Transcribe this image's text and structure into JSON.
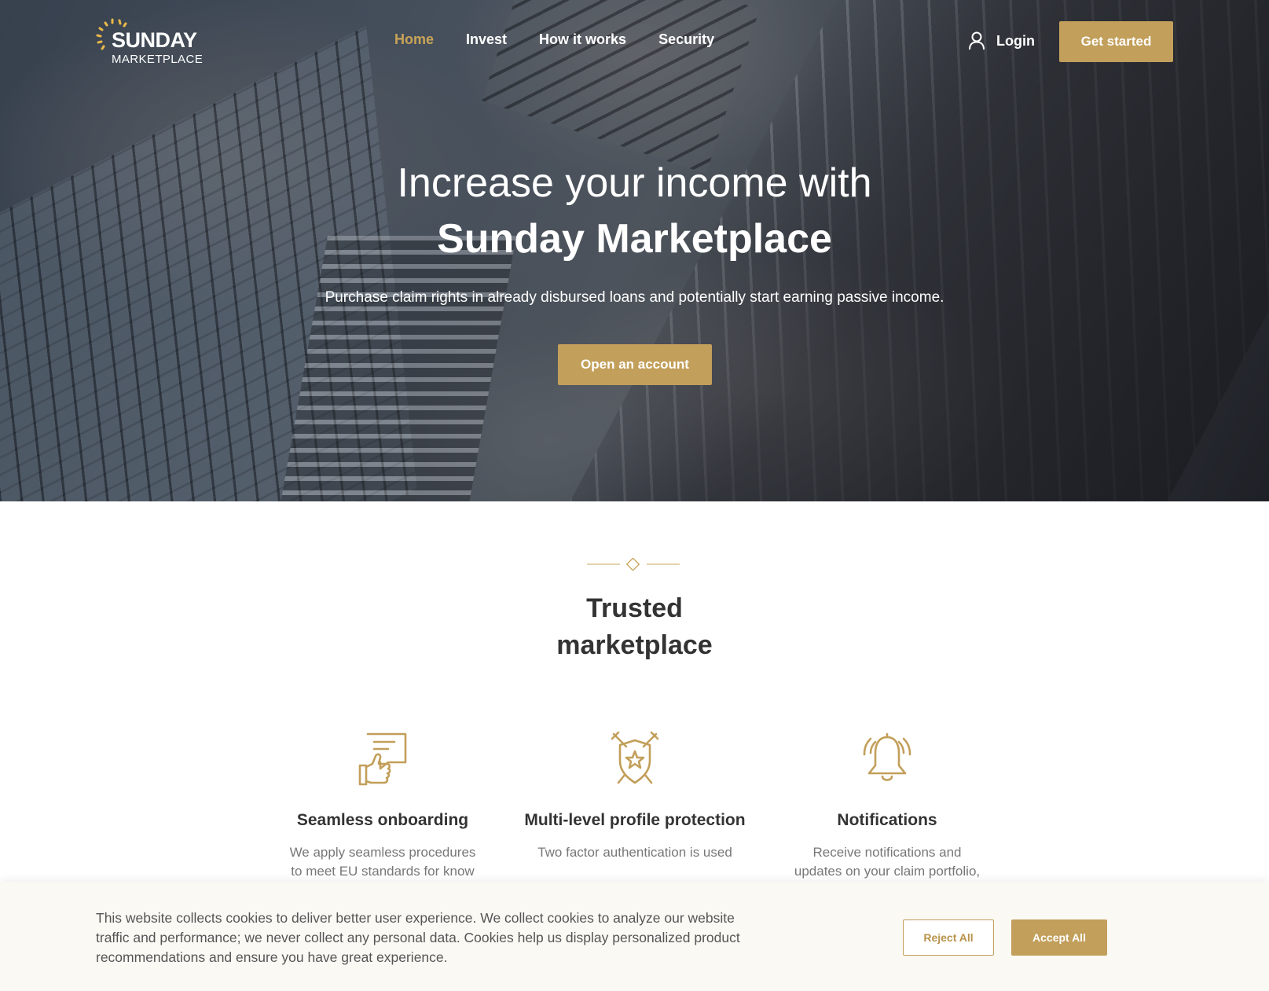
{
  "brand": {
    "name": "SUNDAY",
    "tagline": "MARKETPLACE",
    "accent": "#c29f5a"
  },
  "nav": {
    "links": [
      {
        "label": "Home",
        "active": true
      },
      {
        "label": "Invest",
        "active": false
      },
      {
        "label": "How it works",
        "active": false
      },
      {
        "label": "Security",
        "active": false
      }
    ],
    "login_label": "Login",
    "login_icon": "user-icon",
    "cta_label": "Get started"
  },
  "hero": {
    "title_line1": "Increase your income with",
    "title_line2": "Sunday Marketplace",
    "subtitle": "Purchase claim rights in already disbursed loans and potentially start earning passive income.",
    "cta_label": "Open an account"
  },
  "trusted": {
    "line1": "Trusted",
    "line2": "marketplace",
    "features": [
      {
        "icon": "thumbs-up-chat-icon",
        "title": "Seamless onboarding",
        "text": "We apply seamless procedures to meet EU standards for know"
      },
      {
        "icon": "shield-swords-icon",
        "title": "Multi-level profile protection",
        "text": "Two factor authentication is used"
      },
      {
        "icon": "bell-icon",
        "title": "Notifications",
        "text": "Receive notifications and updates on your claim portfolio,"
      }
    ]
  },
  "cookie": {
    "text": "This website collects cookies to deliver better user experience. We collect cookies to analyze our website traffic and performance; we never collect any personal data. Cookies help us display personalized product recommendations and ensure you have great experience.",
    "reject_label": "Reject All",
    "accept_label": "Accept All"
  }
}
